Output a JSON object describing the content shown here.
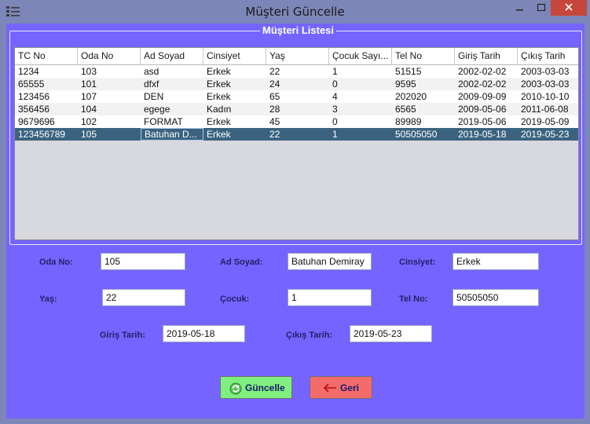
{
  "window": {
    "title": "Müşteri Güncelle",
    "minimize": "–",
    "maximize": "□",
    "close": "✕"
  },
  "group": {
    "title": "Müşteri Listesi"
  },
  "table": {
    "columns": [
      "TC No",
      "Oda No",
      "Ad Soyad",
      "Cinsiyet",
      "Yaş",
      "Çocuk Sayı...",
      "Tel No",
      "Giriş Tarih",
      "Çıkış Tarih"
    ],
    "rows": [
      [
        "1234",
        "103",
        "asd",
        "Erkek",
        "22",
        "1",
        "51515",
        "2002-02-02",
        "2003-03-03"
      ],
      [
        "65555",
        "101",
        "dfxf",
        "Erkek",
        "24",
        "0",
        "9595",
        "2002-02-02",
        "2003-03-03"
      ],
      [
        "123456",
        "107",
        "DEN",
        "Erkek",
        "65",
        "4",
        "202020",
        "2009-09-09",
        "2010-10-10"
      ],
      [
        "356456",
        "104",
        "egege",
        "Kadın",
        "28",
        "3",
        "6565",
        "2009-05-06",
        "2011-06-08"
      ],
      [
        "9679696",
        "102",
        "FORMAT",
        "Erkek",
        "45",
        "0",
        "89989",
        "2019-05-06",
        "2019-05-09"
      ],
      [
        "123456789",
        "105",
        "Batuhan D...",
        "Erkek",
        "22",
        "1",
        "50505050",
        "2019-05-18",
        "2019-05-23"
      ]
    ],
    "selected_row": 5
  },
  "form": {
    "oda_no": {
      "label": "Oda No:",
      "value": "105"
    },
    "ad_soyad": {
      "label": "Ad Soyad:",
      "value": "Batuhan Demiray"
    },
    "cinsiyet": {
      "label": "Cinsiyet:",
      "value": "Erkek"
    },
    "yas": {
      "label": "Yaş:",
      "value": "22"
    },
    "cocuk": {
      "label": "Çocuk:",
      "value": "1"
    },
    "tel_no": {
      "label": "Tel No:",
      "value": "50505050"
    },
    "giris_tarih": {
      "label": "Giriş Tarih:",
      "value": "2019-05-18"
    },
    "cikis_tarih": {
      "label": "Çıkış Tarih:",
      "value": "2019-05-23"
    }
  },
  "buttons": {
    "guncelle": "Güncelle",
    "geri": "Geri"
  },
  "colors": {
    "content_bg": "#7564ff",
    "frame_bg": "#7d86b8",
    "selected_row": "#3b6380",
    "update_button": "#7ff07f",
    "back_button": "#f46b6b"
  }
}
